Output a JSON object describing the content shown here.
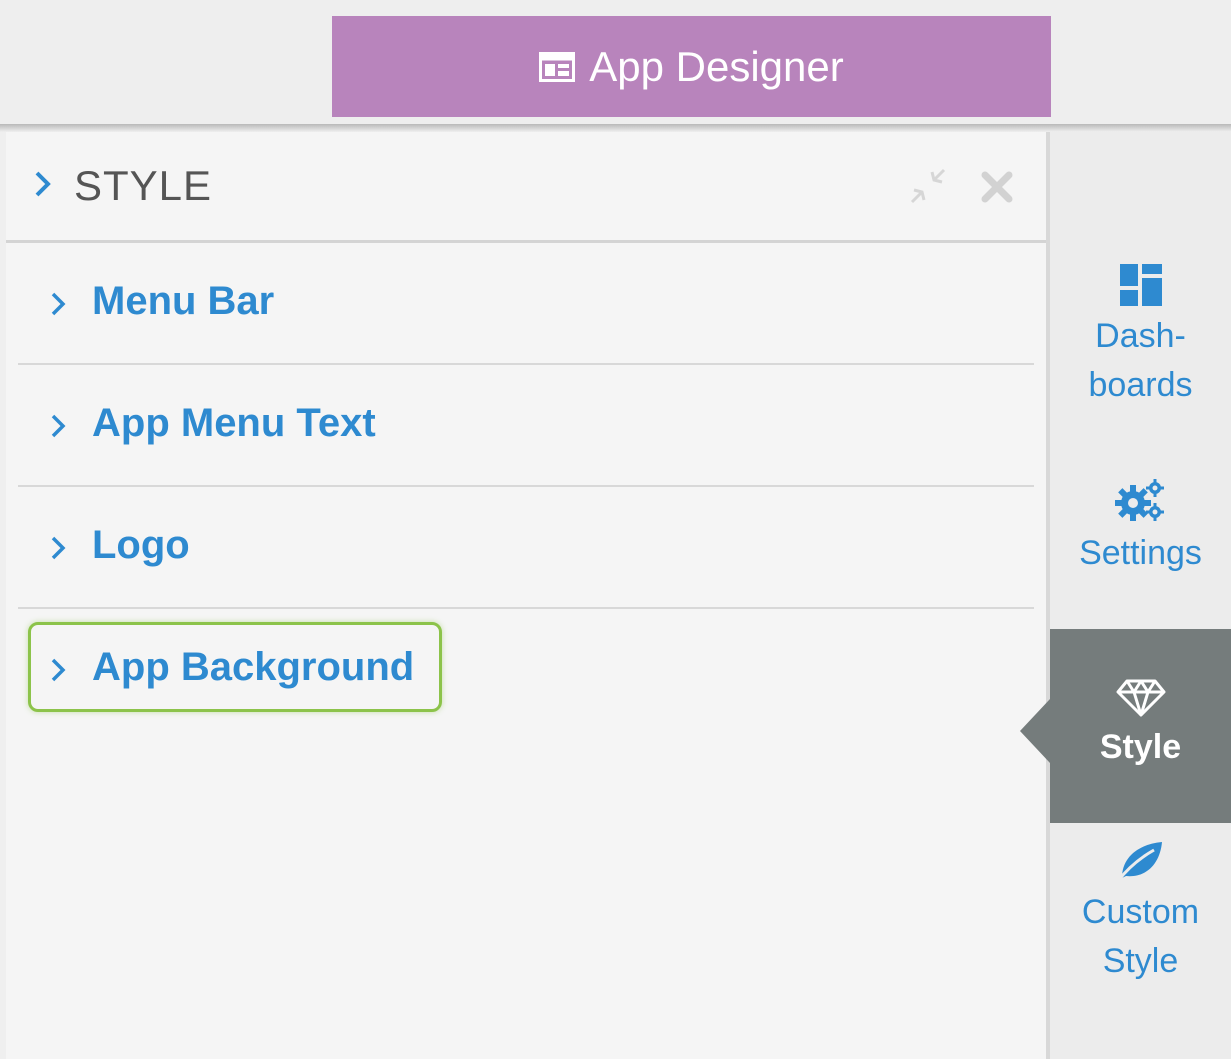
{
  "window": {
    "title": "App Designer",
    "title_icon": "dashboard-layout-icon",
    "accent_color": "#b884bc"
  },
  "panel": {
    "title": "STYLE",
    "header_icons": [
      "compress-icon",
      "close-icon"
    ],
    "sections": [
      {
        "label": "Menu Bar"
      },
      {
        "label": "App Menu Text"
      },
      {
        "label": "Logo"
      },
      {
        "label": "App Background",
        "highlighted": true
      }
    ],
    "link_color": "#2e8ad0",
    "highlight_color": "#8cc34a"
  },
  "sidebar": {
    "items": [
      {
        "label": "Dash-\nboards",
        "icon": "dashboards-icon",
        "active": false
      },
      {
        "label": "Settings",
        "icon": "gears-icon",
        "active": false
      },
      {
        "label": "Style",
        "icon": "diamond-icon",
        "active": true
      },
      {
        "label": "Custom\nStyle",
        "icon": "leaf-icon",
        "active": false
      }
    ],
    "active_color": "#757c7c"
  }
}
